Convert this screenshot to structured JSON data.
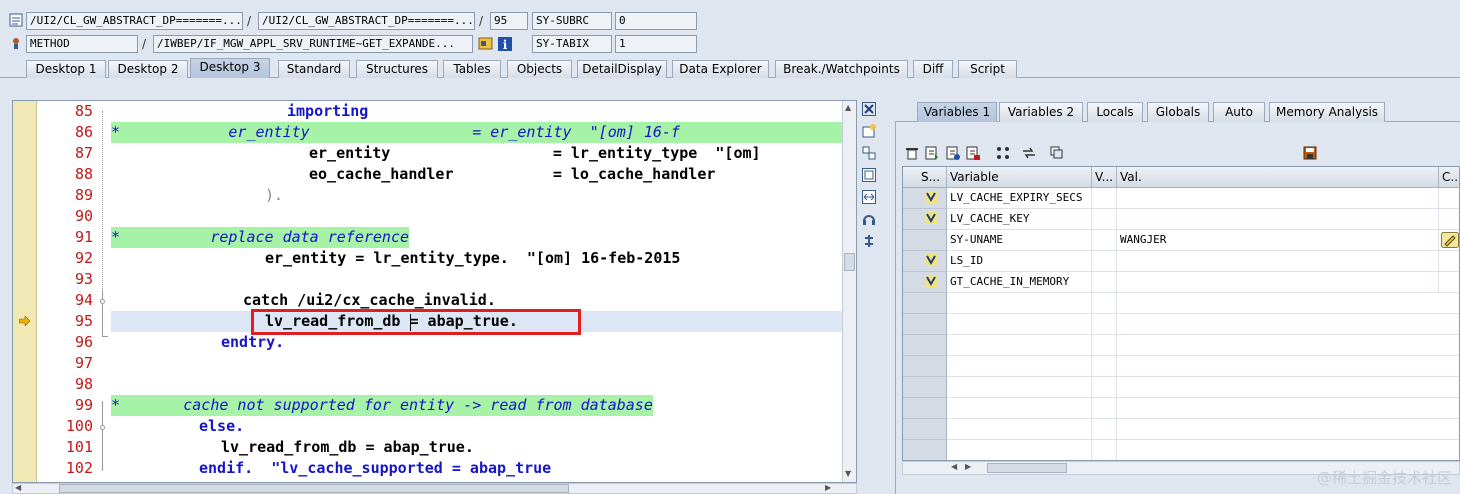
{
  "top": {
    "row1": {
      "field1": "/UI2/CL_GW_ABSTRACT_DP=======...",
      "field2": "/UI2/CL_GW_ABSTRACT_DP=======...",
      "line": "95",
      "var_name": "SY-SUBRC",
      "var_value": "0"
    },
    "row2": {
      "type": "METHOD",
      "method": "/IWBEP/IF_MGW_APPL_SRV_RUNTIME~GET_EXPANDE...",
      "var_name": "SY-TABIX",
      "var_value": "1"
    },
    "sep": "/"
  },
  "tabs": [
    "Desktop 1",
    "Desktop 2",
    "Desktop 3",
    "Standard",
    "Structures",
    "Tables",
    "Objects",
    "DetailDisplay",
    "Data Explorer",
    "Break./Watchpoints",
    "Diff",
    "Script"
  ],
  "code": {
    "current_line": "95",
    "lines": [
      {
        "n": "85",
        "text": "importing"
      },
      {
        "n": "86",
        "text": "*            er_entity                  = er_entity  \"[om] 16-f"
      },
      {
        "n": "87",
        "text": "er_entity                  = lr_entity_type  \"[om]"
      },
      {
        "n": "88",
        "text": "eo_cache_handler           = lo_cache_handler"
      },
      {
        "n": "89",
        "text": ")."
      },
      {
        "n": "90",
        "text": ""
      },
      {
        "n": "91",
        "text": "*          replace data reference"
      },
      {
        "n": "92",
        "text": "er_entity = lr_entity_type.  \"[om] 16-feb-2015"
      },
      {
        "n": "93",
        "text": ""
      },
      {
        "n": "94",
        "text": "catch /ui2/cx_cache_invalid."
      },
      {
        "n": "95",
        "text": "lv_read_from_db = abap_true."
      },
      {
        "n": "96",
        "text": "endtry."
      },
      {
        "n": "97",
        "text": ""
      },
      {
        "n": "98",
        "text": ""
      },
      {
        "n": "99",
        "text": "*       cache not supported for entity -> read from database"
      },
      {
        "n": "100",
        "text": "else."
      },
      {
        "n": "101",
        "text": "lv_read_from_db = abap_true."
      },
      {
        "n": "102",
        "text": "endif.  \"lv_cache_supported = abap_true"
      }
    ]
  },
  "var_tabs": [
    "Variables 1",
    "Variables 2",
    "Locals",
    "Globals",
    "Auto",
    "Memory Analysis"
  ],
  "grid": {
    "headers": [
      "S...",
      "Variable",
      "V...",
      "Val.",
      "C..."
    ],
    "rows": [
      {
        "variable": "LV_CACHE_EXPIRY_SECS",
        "value": ""
      },
      {
        "variable": "LV_CACHE_KEY",
        "value": ""
      },
      {
        "variable": "SY-UNAME",
        "value": "WANGJER"
      },
      {
        "variable": "LS_ID",
        "value": ""
      },
      {
        "variable": "GT_CACHE_IN_MEMORY",
        "value": ""
      }
    ]
  },
  "watermark": "@稀土掘金技术社区",
  "colors": {
    "highlight_box": "#e02020",
    "comment_bg": "#a6f2a6",
    "keyword": "#1515c8",
    "line_number": "#c41818"
  }
}
